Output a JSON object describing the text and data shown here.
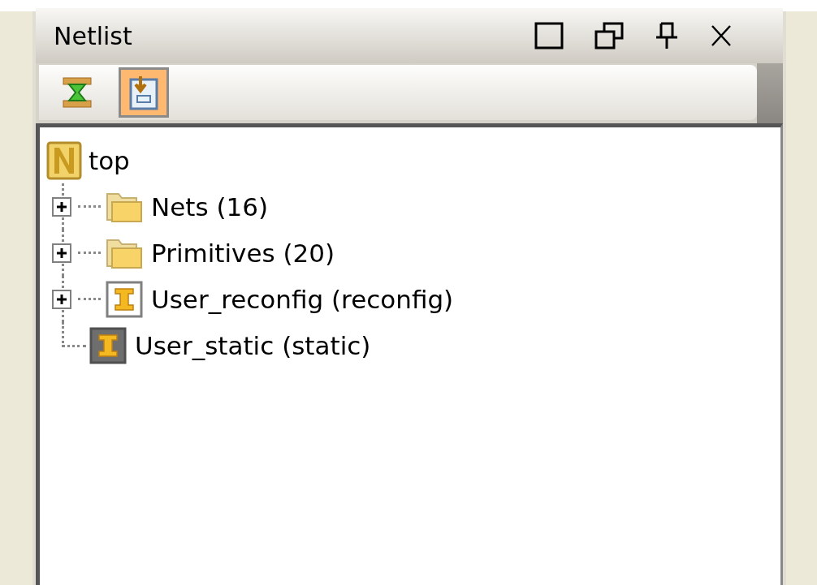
{
  "panel": {
    "title": "Netlist"
  },
  "toolbar": [
    {
      "kind": "hourglass",
      "selected": false
    },
    {
      "kind": "document",
      "selected": true
    }
  ],
  "tree": {
    "label": "top",
    "kind": "netlist",
    "children": [
      {
        "label": "Nets (16)",
        "kind": "folder",
        "expandable": true,
        "expanded": false
      },
      {
        "label": "Primitives (20)",
        "kind": "folder",
        "expandable": true,
        "expanded": false
      },
      {
        "label": "User_reconfig (reconfig)",
        "kind": "instance",
        "expandable": true,
        "expanded": false
      },
      {
        "label": "User_static (static)",
        "kind": "instance-dark",
        "expandable": false
      }
    ]
  }
}
